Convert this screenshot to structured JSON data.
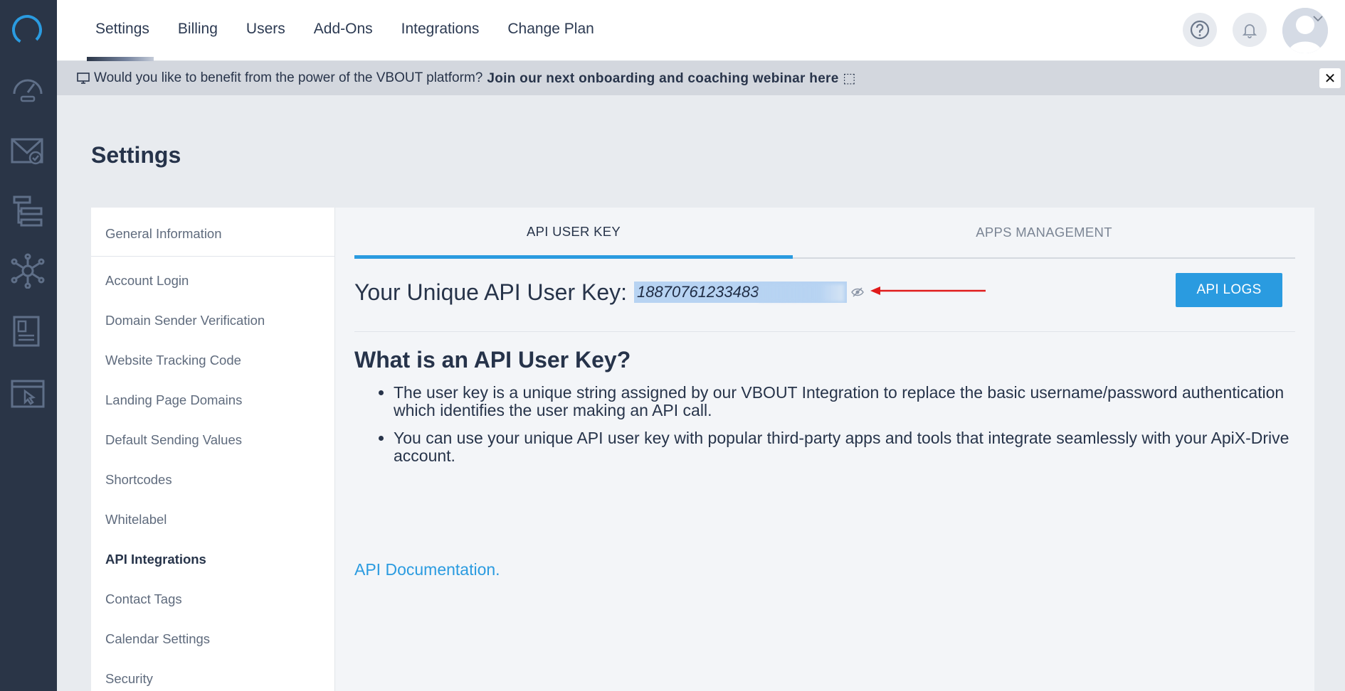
{
  "nav": {
    "tabs": [
      "Settings",
      "Billing",
      "Users",
      "Add-Ons",
      "Integrations",
      "Change Plan"
    ]
  },
  "banner": {
    "text": "Would you like to benefit from the power of the VBOUT platform?",
    "link": "Join our next onboarding and coaching webinar here ⬚",
    "close": "✕"
  },
  "page": {
    "title": "Settings"
  },
  "sidebar": {
    "items": [
      "General Information",
      "Account Login",
      "Domain Sender Verification",
      "Website Tracking Code",
      "Landing Page Domains",
      "Default Sending Values",
      "Shortcodes",
      "Whitelabel",
      "API Integrations",
      "Contact Tags",
      "Calendar Settings",
      "Security"
    ],
    "active": "API Integrations"
  },
  "panel": {
    "tabs": [
      "API USER KEY",
      "APPS MANAGEMENT"
    ],
    "key_label": "Your Unique API User Key:",
    "key_value": "18870761233483",
    "api_logs": "API LOGS",
    "heading": "What is an API User Key?",
    "bullets": [
      "The user key is a unique string assigned by our VBOUT Integration to replace the basic username/password authentication which identifies the user making an API call.",
      "You can use your unique API user key with popular third-party apps and tools that integrate seamlessly with your ApiX-Drive account."
    ],
    "doc_link": "API Documentation."
  },
  "colors": {
    "rail": "#2a3547",
    "accent": "#2a9be0",
    "arrow": "#e01b1b",
    "highlight": "#b7d3f2"
  }
}
